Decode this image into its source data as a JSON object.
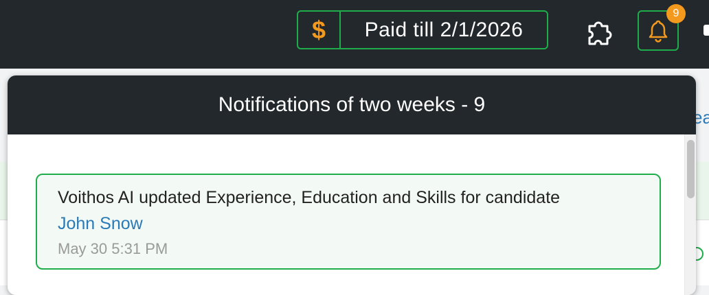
{
  "topbar": {
    "paid_icon": "$",
    "paid_text": "Paid till 2/1/2026",
    "notification_count": "9",
    "icons": {
      "extensions": "puzzle-icon",
      "notifications": "bell-icon"
    }
  },
  "background": {
    "link_fragment": "ea"
  },
  "popup": {
    "title": "Notifications of two weeks - 9",
    "notifications": [
      {
        "message": "Voithos AI updated Experience, Education and Skills for candidate",
        "candidate": "John Snow",
        "time": "May 30 5:31 PM"
      }
    ]
  },
  "colors": {
    "accent_green": "#1fad4b",
    "accent_orange": "#f39a1e",
    "header_dark": "#23282c",
    "link_blue": "#2a7ab8"
  }
}
